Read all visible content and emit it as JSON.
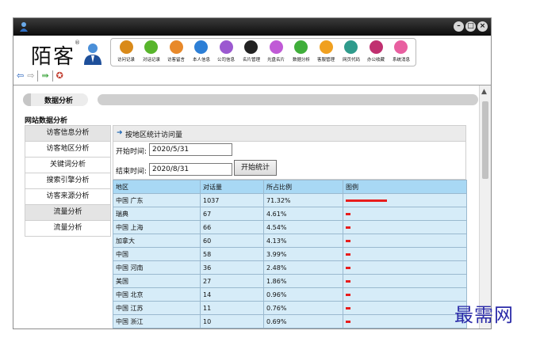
{
  "brand": {
    "logo_text": "陌客",
    "reg_mark": "®"
  },
  "nav_items": [
    {
      "label": "访问记录",
      "icon": "person-icon",
      "color": "#d98a1a"
    },
    {
      "label": "对话记录",
      "icon": "chat-icon",
      "color": "#58b52c"
    },
    {
      "label": "访客留言",
      "icon": "message-icon",
      "color": "#e8892a"
    },
    {
      "label": "本人信息",
      "icon": "user-info-icon",
      "color": "#2d7fd6"
    },
    {
      "label": "公司信息",
      "icon": "company-icon",
      "color": "#9b59d0"
    },
    {
      "label": "名片管理",
      "icon": "card-icon",
      "color": "#222222"
    },
    {
      "label": "光盘名片",
      "icon": "disc-icon",
      "color": "#c05ad6"
    },
    {
      "label": "数据分析",
      "icon": "chart-icon",
      "color": "#3fae3a"
    },
    {
      "label": "客服管理",
      "icon": "service-icon",
      "color": "#f0a020"
    },
    {
      "label": "网页代码",
      "icon": "code-icon",
      "color": "#2f9b8c"
    },
    {
      "label": "办公收藏",
      "icon": "favorite-icon",
      "color": "#c03070"
    },
    {
      "label": "系统消息",
      "icon": "system-message-icon",
      "color": "#e85fa0"
    }
  ],
  "page_tab": {
    "label": "数据分析"
  },
  "section_title": "网站数据分析",
  "side_menu": [
    {
      "label": "访客信息分析",
      "header": true
    },
    {
      "label": "访客地区分析",
      "header": false
    },
    {
      "label": "关键词分析",
      "header": false
    },
    {
      "label": "搜索引擎分析",
      "header": false
    },
    {
      "label": "访客来源分析",
      "header": false
    },
    {
      "label": "流量分析",
      "header": true
    },
    {
      "label": "流量分析",
      "header": false
    }
  ],
  "panel": {
    "title": "按地区统计访问量",
    "start_label": "开始时间:",
    "start_value": "2020/5/31",
    "end_label": "结束时间:",
    "end_value": "2020/8/31",
    "submit_label": "开始统计"
  },
  "table": {
    "headers": [
      "地区",
      "对话量",
      "所占比例",
      "图例"
    ],
    "rows": [
      {
        "region": "中国 广东",
        "count": "1037",
        "percent": "71.32%",
        "share": 0.7132
      },
      {
        "region": "瑞典",
        "count": "67",
        "percent": "4.61%",
        "share": 0.0461
      },
      {
        "region": "中国 上海",
        "count": "66",
        "percent": "4.54%",
        "share": 0.0454
      },
      {
        "region": "加拿大",
        "count": "60",
        "percent": "4.13%",
        "share": 0.0413
      },
      {
        "region": "中国",
        "count": "58",
        "percent": "3.99%",
        "share": 0.0399
      },
      {
        "region": "中国 河南",
        "count": "36",
        "percent": "2.48%",
        "share": 0.0248
      },
      {
        "region": "美国",
        "count": "27",
        "percent": "1.86%",
        "share": 0.0186
      },
      {
        "region": "中国 北京",
        "count": "14",
        "percent": "0.96%",
        "share": 0.0096
      },
      {
        "region": "中国 江苏",
        "count": "11",
        "percent": "0.76%",
        "share": 0.0076
      },
      {
        "region": "中国 浙江",
        "count": "10",
        "percent": "0.69%",
        "share": 0.0069
      }
    ]
  },
  "watermark": "最需网",
  "colors": {
    "legend_bar": "#e81d1d",
    "table_header": "#a8d8f4",
    "table_cell": "#d6ecf8"
  }
}
